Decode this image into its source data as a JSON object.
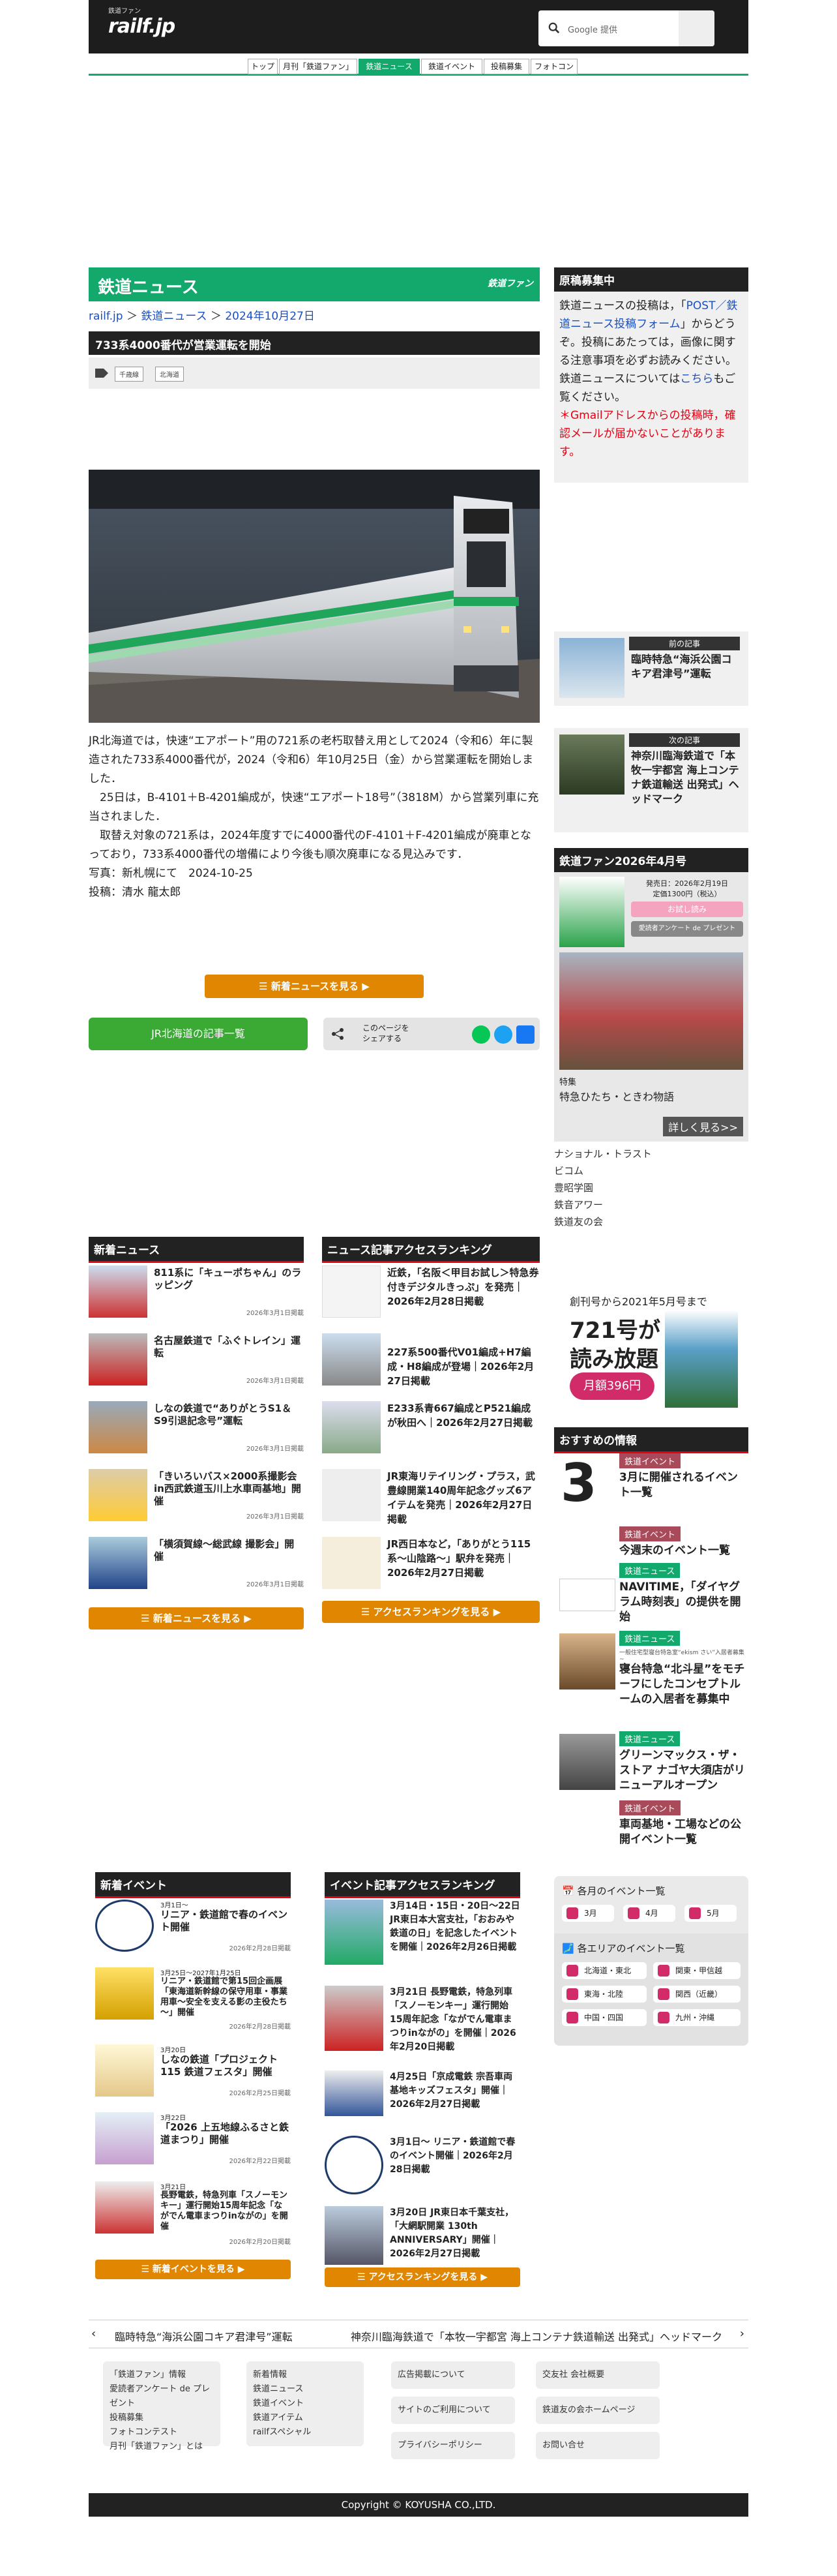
{
  "header": {
    "site_small": "鉄道ファン",
    "site_brand": "railf.jp",
    "search_placeholder": "Google 提供"
  },
  "nav": {
    "tabs": [
      "トップ",
      "月刊「鉄道ファン」",
      "鉄道ニュース",
      "鉄道イベント",
      "投稿募集",
      "フォトコン"
    ]
  },
  "article": {
    "section": "鉄道ニュース",
    "section_logo": "鉄道ファン",
    "crumb": {
      "home": "railf.jp",
      "sep1": "＞",
      "cat": "鉄道ニュース",
      "sep2": "＞",
      "date": "2024年10月27日"
    },
    "title": "733系4000番代が営業運転を開始",
    "tags": [
      "千歳線",
      "北海道"
    ],
    "paragraphs": [
      "JR北海道では，快速“エアポート”用の721系の老朽取替え用として2024（令和6）年に製造された733系4000番代が，2024（令和6）年10月25日（金）から営業運転を開始しました．",
      "　25日は，B-4101＋B-4201編成が，快速“エアポート18号”（3818M）から営業列車に充当されました．",
      "　取替え対象の721系は，2024年度すでに4000番代のF-4101＋F-4201編成が廃車となっており，733系4000番代の増備により今後も順次廃車になる見込みです．",
      "写真：新札幌にて　2024-10-25",
      "投稿：清水 龍太郎"
    ],
    "more_news_btn": "新着ニュースを見る",
    "jr_btn": "JR北海道の記事一覧",
    "share_label": "このページを\nシェアする"
  },
  "sidebar": {
    "recruit_title": "原稿募集中",
    "recruit_text1": "鉄道ニュースの投稿は，「",
    "recruit_link": "POST／鉄道ニュース投稿フォーム",
    "recruit_text2": "」からどうぞ。投稿にあたっては，画像に関する注意事項を必ずお読みください。",
    "recruit_text3": "鉄道ニュースについては",
    "recruit_link2": "こちら",
    "recruit_text4": "もご覧ください。",
    "recruit_warn": "＊Gmailアドレスからの投稿時，確認メールが届かないことがあります。",
    "prev_label": "前の記事",
    "prev_title": "臨時特急“海浜公園コキア君津号”運転",
    "next_label": "次の記事",
    "next_title": "神奈川臨海鉄道で「本牧一宇都宮 海上コンテナ鉄道輸送 出発式」ヘッドマーク",
    "mag_title": "鉄道ファン2026年4月号",
    "mag_release": "発売日：2026年2月19日",
    "mag_price": "定価1300円（税込）",
    "mag_btn1": "お試し読み",
    "mag_btn2": "愛読者アンケート de プレゼント",
    "mag_feature_label": "特集",
    "mag_feature": "特急ひたち・ときわ物語",
    "mag_more": "詳しく見る>>",
    "sponsors": [
      "ナショナル・トラスト",
      "ビコム",
      "豊昭学園",
      "鉄音アワー",
      "鉄道友の会"
    ],
    "sub_promo_1": "創刊号から2021年5月号まで",
    "sub_promo_2": "721号が",
    "sub_promo_3": "読み放題",
    "sub_promo_price": "月額396円",
    "rec_title": "おすすめの情報",
    "rec_items": [
      {
        "cat": "鉄道イベント",
        "title": "3月に開催されるイベント一覧",
        "color": "#a84a5a"
      },
      {
        "cat": "鉄道イベント",
        "title": "今週末のイベント一覧",
        "color": "#a84a5a"
      },
      {
        "cat": "鉄道ニュース",
        "title": "NAVITIME，「ダイヤグラム時刻表」の提供を開始",
        "color": "#13a96d"
      },
      {
        "cat": "鉄道ニュース",
        "title": "寝台特急“北斗星”をモチーフにしたコンセプトルームの入居者を募集中",
        "color": "#13a96d"
      },
      {
        "cat": "鉄道ニュース",
        "title": "グリーンマックス・ザ・ストア ナゴヤ大須店がリニューアルオープン",
        "color": "#13a96d"
      },
      {
        "cat": "鉄道イベント",
        "title": "車両基地・工場などの公開イベント一覧",
        "color": "#a84a5a"
      }
    ],
    "rec_big_num": "3",
    "rec_small_note": "一般住宅型寝台特急室“ekism さい”入居者募集 ~"
  },
  "news_list": {
    "title": "新着ニュース",
    "items": [
      {
        "title": "811系に「キューポちゃん」のラッピング",
        "date": "2026年3月1日掲載"
      },
      {
        "title": "名古屋鉄道で「ふぐトレイン」運転",
        "date": "2026年3月1日掲載"
      },
      {
        "title": "しなの鉄道で“ありがとうS1＆S9引退記念号”運転",
        "date": "2026年3月1日掲載"
      },
      {
        "title": "「きいろいバス×2000系撮影会in西武鉄道玉川上水車両基地」開催",
        "date": "2026年3月1日掲載"
      },
      {
        "title": "「横須賀線～総武線 撮影会」開催",
        "date": "2026年3月1日掲載"
      }
    ],
    "btn": "新着ニュースを見る"
  },
  "news_rank": {
    "title": "ニュース記事アクセスランキング",
    "items": [
      {
        "title": "近鉄，「名阪＜甲目お試し＞特急券付きデジタルきっぷ」を発売｜2026年2月28日掲載"
      },
      {
        "title": "227系500番代V01編成+H7編成・H8編成が登場｜2026年2月27日掲載"
      },
      {
        "title": "E233系青667編成とP521編成が秋田へ｜2026年2月27日掲載"
      },
      {
        "title": "JR東海リテイリング・プラス，武豊線開業140周年記念グッズ6アイテムを発売｜2026年2月27日掲載"
      },
      {
        "title": "JR西日本など，「ありがとう115系～山陰路～」駅弁を発売｜2026年2月27日掲載"
      }
    ],
    "btn": "アクセスランキングを見る"
  },
  "event_list": {
    "title": "新着イベント",
    "items": [
      {
        "when": "3月1日～",
        "title": "リニア・鉄道館で春のイベント開催",
        "date": "2026年2月28日掲載"
      },
      {
        "when": "3月25日～2027年1月25日",
        "title": "リニア・鉄道館で第15回企画展「東海道新幹線の保守用車・事業用車～安全を支える影の主役たち～」開催",
        "date": "2026年2月28日掲載"
      },
      {
        "when": "3月20日",
        "title": "しなの鉄道「プロジェクト115 鉄道フェスタ」開催",
        "date": "2026年2月25日掲載"
      },
      {
        "when": "3月22日",
        "title": "「2026 上五地線ふるさと鉄道まつり」開催",
        "date": "2026年2月22日掲載"
      },
      {
        "when": "3月21日",
        "title": "長野電鉄，特急列車「スノーモンキー」運行開始15周年記念「ながでん電車まつりinながの」を開催",
        "date": "2026年2月20日掲載"
      }
    ],
    "btn": "新着イベントを見る"
  },
  "event_rank": {
    "title": "イベント記事アクセスランキング",
    "items": [
      {
        "title": "3月14日・15日・20日～22日 JR東日本大宮支社，「おおみや鉄道の日」を記念したイベントを開催｜2026年2月26日掲載"
      },
      {
        "title": "3月21日 長野電鉄，特急列車「スノーモンキー」運行開始15周年記念「ながでん電車まつりinながの」を開催｜2026年2月20日掲載"
      },
      {
        "title": "4月25日「京成電鉄 宗吾車両基地キッズフェスタ」開催｜2026年2月27日掲載"
      },
      {
        "title": "3月1日～ リニア・鉄道館で春のイベント開催｜2026年2月28日掲載"
      },
      {
        "title": "3月20日 JR東日本千葉支社，「大網駅開業 130th ANNIVERSARY」開催｜2026年2月27日掲載"
      }
    ],
    "btn": "アクセスランキングを見る"
  },
  "calendar": {
    "month_title": "各月のイベント一覧",
    "months": [
      "3月",
      "4月",
      "5月"
    ],
    "area_title": "各エリアのイベント一覧",
    "areas": [
      "北海道・東北",
      "関東・甲信越",
      "東海・北陸",
      "関西（近畿）",
      "中国・四国",
      "九州・沖縄"
    ]
  },
  "bottom_nav": {
    "prev": "臨時特急“海浜公園コキア君津号”運転",
    "next": "神奈川臨海鉄道で「本牧一宇都宮 海上コンテナ鉄道輸送 出発式」ヘッドマーク"
  },
  "footer": {
    "col1": [
      "「鉄道ファン」情報",
      "愛読者アンケート de プレゼント",
      "投稿募集",
      "フォトコンテスト",
      "月刊「鉄道ファン」とは"
    ],
    "col2": [
      "新着情報",
      "鉄道ニュース",
      "鉄道イベント",
      "鉄道アイテム",
      "railfスペシャル"
    ],
    "col3": [
      "広告掲載について",
      "サイトのご利用について",
      "プライバシーポリシー"
    ],
    "col4": [
      "交友社 会社概要",
      "鉄道友の会ホームページ",
      "お問い合せ"
    ],
    "copyright": "Copyright © KOYUSHA CO.,LTD."
  }
}
